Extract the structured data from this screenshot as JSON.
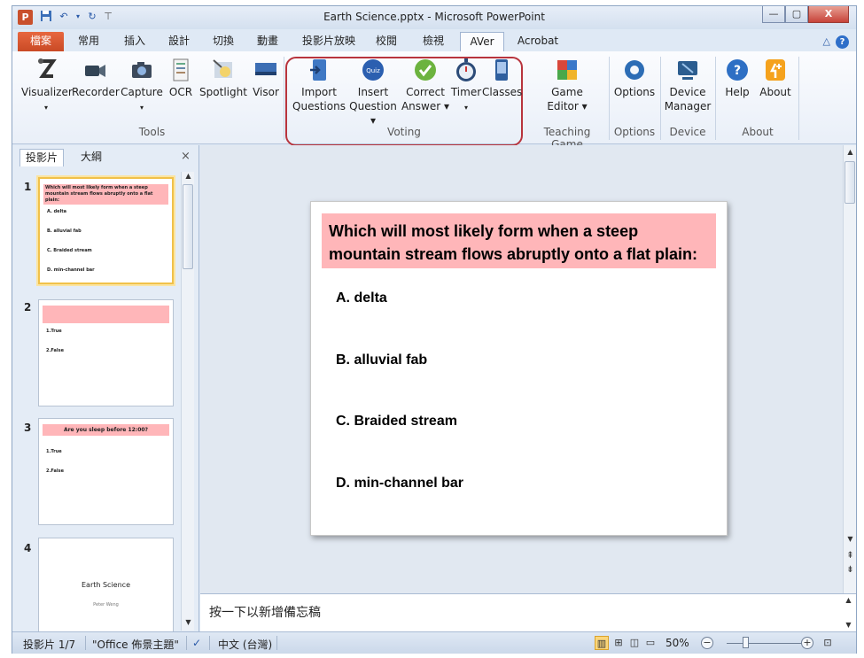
{
  "window": {
    "title": "Earth Science.pptx - Microsoft PowerPoint",
    "app_badge": "P",
    "controls": {
      "minimize": "—",
      "maximize": "▢",
      "close": "X"
    }
  },
  "tabs": [
    {
      "label": "檔案"
    },
    {
      "label": "常用"
    },
    {
      "label": "插入"
    },
    {
      "label": "設計"
    },
    {
      "label": "切換"
    },
    {
      "label": "動畫"
    },
    {
      "label": "投影片放映"
    },
    {
      "label": "校閱"
    },
    {
      "label": "檢視"
    },
    {
      "label": "AVer"
    },
    {
      "label": "Acrobat"
    }
  ],
  "ribbon": {
    "tools": {
      "label": "Tools",
      "visualizer": "Visualizer",
      "recorder": "Recorder",
      "capture": "Capture",
      "ocr": "OCR",
      "spotlight": "Spotlight",
      "visor": "Visor"
    },
    "voting": {
      "label": "Voting",
      "import_1": "Import",
      "import_2": "Questions",
      "insert_1": "Insert",
      "insert_2": "Question ▾",
      "correct_1": "Correct",
      "correct_2": "Answer ▾",
      "timer": "Timer",
      "classes": "Classes",
      "quiz_badge": "Quiz"
    },
    "teaching_game": {
      "label": "Teaching Game",
      "game_1": "Game",
      "game_2": "Editor ▾"
    },
    "options": {
      "label": "Options",
      "button": "Options"
    },
    "device": {
      "label": "Device",
      "btn_1": "Device",
      "btn_2": "Manager"
    },
    "about": {
      "label": "About",
      "help": "Help",
      "about": "About"
    }
  },
  "side_panel": {
    "tabs": [
      "投影片",
      "大綱"
    ],
    "close": "×",
    "thumbs": [
      {
        "num": "1",
        "title": "Which will most likely form when a steep mountain stream flows abruptly onto a flat plain:",
        "items": [
          "A. delta",
          "B. alluvial fab",
          "C. Braided stream",
          "D. min-channel bar"
        ]
      },
      {
        "num": "2",
        "items": [
          "1.True",
          "2.False"
        ]
      },
      {
        "num": "3",
        "title": "Are you sleep before 12:00?",
        "items": [
          "1.True",
          "2.False"
        ]
      },
      {
        "num": "4",
        "main": "Earth Science",
        "sub": "Peter Weng"
      }
    ]
  },
  "slide": {
    "title": "Which will most likely form when a steep mountain stream flows abruptly onto a flat plain:",
    "options": [
      "A. delta",
      "B. alluvial fab",
      "C. Braided stream",
      "D. min-channel bar"
    ]
  },
  "notes": {
    "placeholder": "按一下以新增備忘稿"
  },
  "status": {
    "slide_count": "投影片 1/7",
    "theme": "\"Office 佈景主題\"",
    "language": "中文 (台灣)",
    "zoom": "50%"
  }
}
